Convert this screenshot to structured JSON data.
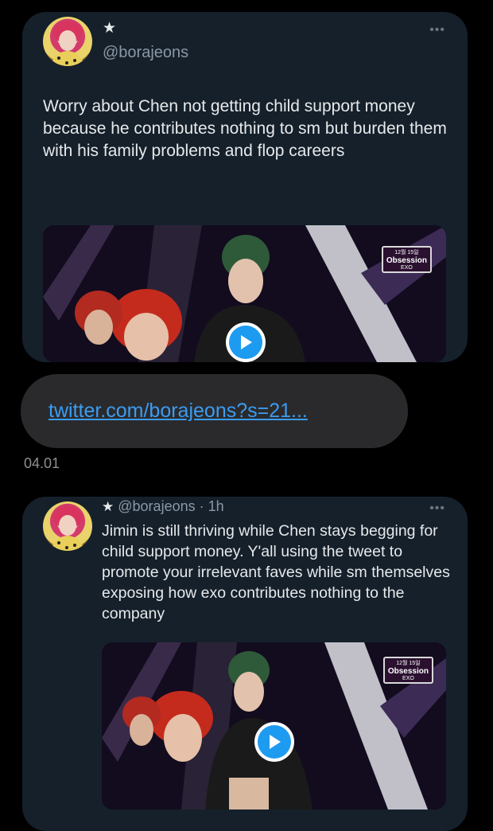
{
  "tweet1": {
    "star": "★",
    "handle": "@borajeons",
    "more": "•••",
    "text": "Worry about Chen not getting child support money because he contributes nothing to sm but burden them with his family problems and flop careers",
    "video_badge": {
      "date": "12월 15일",
      "title": "Obsession",
      "artist": "EXO"
    }
  },
  "message": {
    "link": "twitter.com/borajeons?s=21...",
    "timestamp": "04.01"
  },
  "tweet2": {
    "star": "★",
    "handle": "@borajeons",
    "separator": " · ",
    "time": "1h",
    "more": "•••",
    "text": "Jimin is still thriving while Chen stays begging for child support money. Y'all using the tweet to promote your irrelevant faves while sm themselves exposing how exo contributes nothing to the company",
    "video_badge": {
      "date": "12월 15일",
      "title": "Obsession",
      "artist": "EXO"
    }
  },
  "colors": {
    "card_bg": "#15202b",
    "link": "#3b9cf2",
    "play_accent": "#1d9bf0",
    "bubble": "#2a2a2c"
  }
}
